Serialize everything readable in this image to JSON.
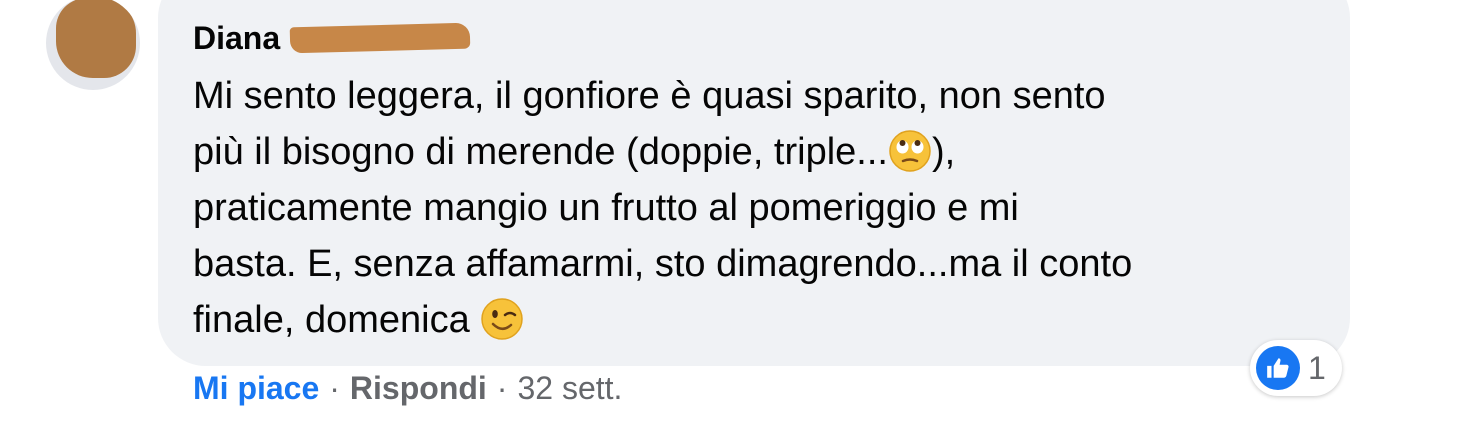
{
  "comment": {
    "author": "Diana",
    "text_lines": [
      [
        "Mi sento leggera, il gonfiore è quasi sparito, non sento"
      ],
      [
        "più il bisogno di merende (doppie, triple...",
        "), "
      ],
      [
        "praticamente mangio un frutto al pomeriggio e mi"
      ],
      [
        "basta. E, senza affamarmi, sto dimagrendo...ma il conto"
      ],
      [
        "finale, domenica "
      ]
    ],
    "emojis": [
      "eye-roll-emoji",
      "wink-emoji"
    ]
  },
  "reactions": {
    "type": "like",
    "count": "1"
  },
  "actions": {
    "like_label": "Mi piace",
    "reply_label": "Rispondi",
    "separator": "·",
    "timestamp": "32 sett."
  },
  "colors": {
    "accent": "#1877f2",
    "bubble": "#f0f2f5",
    "text": "#050505",
    "muted": "#65676b"
  }
}
